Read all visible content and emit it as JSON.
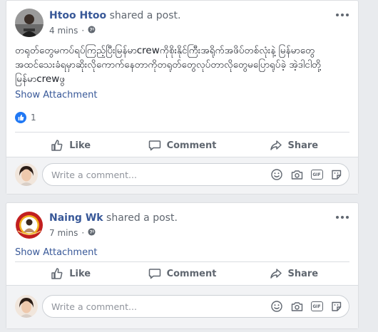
{
  "posts": [
    {
      "author": "Htoo Htoo",
      "action": "shared a post.",
      "time": "4 mins",
      "privacy_icon": "globe-icon",
      "text": "တရုတ်တွေမကပ်ရပ်ကြည့်ပြီးမြန်မာcrewကိုစိုးနိုင်ကြီးအရိုက်အဖိပ်တစ်လုံးနဲ့ မြန်မာတွေအထင်သေးခံရမှာဆိုးလိုကောက်နေတာကိုတရုတ်တွေလုပ်တာလိုတွေမပြောရုပ်ခဲ့ အဲ့ဒါငါတို့မြန်မာcrewဖွ",
      "show_attachment": "Show Attachment",
      "reaction_icon": "like-reaction-icon",
      "reaction_count": "1",
      "actions": {
        "like": "Like",
        "comment": "Comment",
        "share": "Share"
      },
      "comment_placeholder": "Write a comment..."
    },
    {
      "author": "Naing Wk",
      "action": "shared a post.",
      "time": "7 mins",
      "privacy_icon": "globe-icon",
      "show_attachment": "Show Attachment",
      "actions": {
        "like": "Like",
        "comment": "Comment",
        "share": "Share"
      },
      "comment_placeholder": "Write a comment..."
    }
  ],
  "colors": {
    "link": "#385898",
    "secondary_text": "#606770",
    "reaction_blue": "#2078f4",
    "feed_background": "#e9ebee"
  }
}
